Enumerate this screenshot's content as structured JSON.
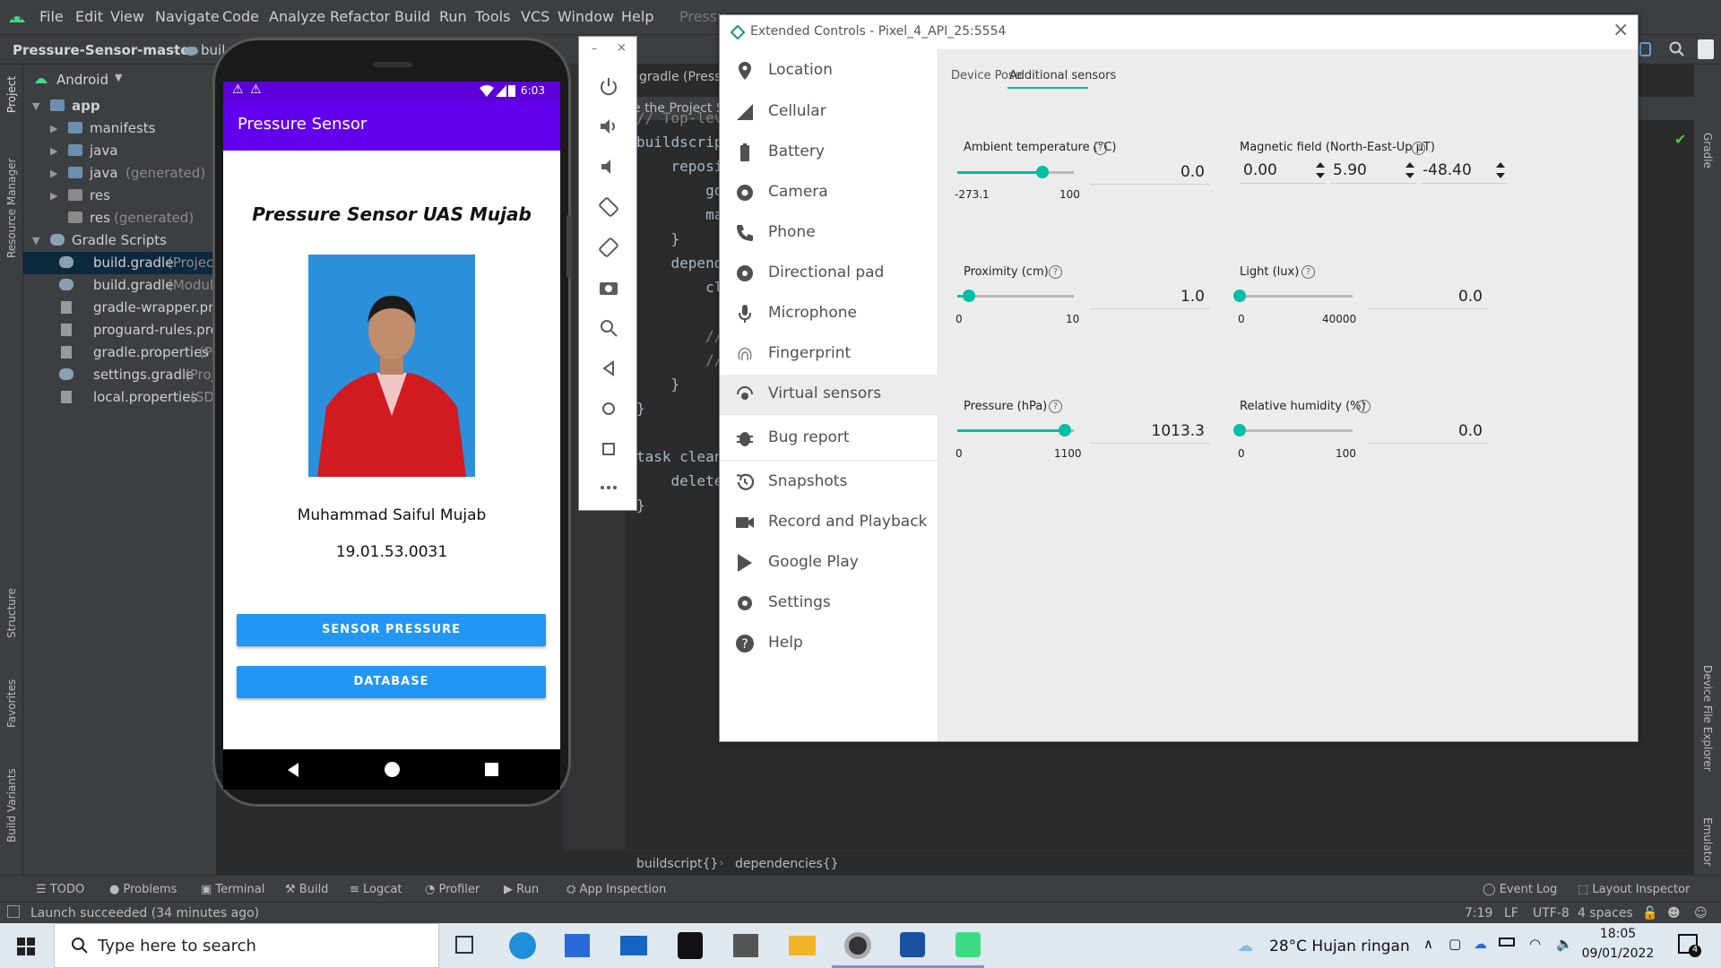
{
  "ide": {
    "menu": [
      "File",
      "Edit",
      "View",
      "Navigate",
      "Code",
      "Analyze",
      "Refactor",
      "Build",
      "Run",
      "Tools",
      "VCS",
      "Window",
      "Help"
    ],
    "menu_title_fragment": "Pressu",
    "nav": {
      "project": "Pressure-Sensor-master",
      "file_fragment": "buil"
    },
    "project_panel": {
      "selector": "Android",
      "tree": [
        {
          "label": "app",
          "hint": ""
        },
        {
          "label": "manifests",
          "hint": ""
        },
        {
          "label": "java",
          "hint": ""
        },
        {
          "label": "java",
          "hint": "(generated)"
        },
        {
          "label": "res",
          "hint": ""
        },
        {
          "label": "res",
          "hint": "(generated)"
        },
        {
          "label": "Gradle Scripts",
          "hint": ""
        },
        {
          "label": "build.gradle",
          "hint": "(Projec"
        },
        {
          "label": "build.gradle",
          "hint": "(Modul"
        },
        {
          "label": "gradle-wrapper.pro",
          "hint": ""
        },
        {
          "label": "proguard-rules.pro",
          "hint": ""
        },
        {
          "label": "gradle.properties",
          "hint": "(P"
        },
        {
          "label": "settings.gradle",
          "hint": "(Proj"
        },
        {
          "label": "local.properties",
          "hint": "(SD"
        }
      ]
    },
    "left_strip": {
      "project": "Project",
      "resource_manager": "Resource Manager",
      "structure": "Structure",
      "favorites": "Favorites",
      "build_variants": "Build Variants"
    },
    "right_strip": {
      "gradle": "Gradle",
      "device_file_explorer": "Device File Explorer",
      "emulator": "Emulator"
    },
    "editor": {
      "tab_fragment": "gradle (Pressure",
      "banner_fragment": "e the Project S",
      "banner_right": "ication",
      "code_lines": [
        "// Top-lev",
        "buildscrip",
        "    reposi",
        "        go",
        "        ma",
        "    }",
        "    depend",
        "        cl",
        "",
        "        //",
        "        //",
        "    }",
        "}",
        "",
        "task clean",
        "    delete",
        "}"
      ],
      "line_numbers": [
        "1",
        "1",
        "1",
        "1",
        "1",
        "1",
        "1",
        "1",
        "1",
        "1",
        "1",
        "1",
        "1",
        "1",
        "1",
        "1",
        "1"
      ],
      "breadcrumb": [
        "buildscript{}",
        "dependencies{}"
      ]
    },
    "bottom_tools": [
      "TODO",
      "Problems",
      "Terminal",
      "Build",
      "Logcat",
      "Profiler",
      "Run",
      "App Inspection"
    ],
    "bottom_tools_right": [
      "Event Log",
      "Layout Inspector"
    ],
    "status": {
      "message": "Launch succeeded (34 minutes ago)",
      "position": "7:19",
      "line_sep": "LF",
      "encoding": "UTF-8",
      "indent": "4 spaces"
    }
  },
  "phone": {
    "time": "6:03",
    "app_title": "Pressure Sensor",
    "heading": "Pressure Sensor UAS Mujab",
    "name": "Muhammad Saiful Mujab",
    "student_id": "19.01.53.0031",
    "button_sensor": "SENSOR PRESSURE",
    "button_database": "DATABASE"
  },
  "extended_controls": {
    "title": "Extended Controls - Pixel_4_API_25:5554",
    "sidebar": [
      {
        "label": "Location",
        "icon": "location-pin-icon"
      },
      {
        "label": "Cellular",
        "icon": "cellular-icon"
      },
      {
        "label": "Battery",
        "icon": "battery-icon"
      },
      {
        "label": "Camera",
        "icon": "camera-aperture-icon"
      },
      {
        "label": "Phone",
        "icon": "phone-icon"
      },
      {
        "label": "Directional pad",
        "icon": "dpad-icon"
      },
      {
        "label": "Microphone",
        "icon": "microphone-icon"
      },
      {
        "label": "Fingerprint",
        "icon": "fingerprint-icon"
      },
      {
        "label": "Virtual sensors",
        "icon": "virtual-sensors-icon"
      },
      {
        "label": "Bug report",
        "icon": "bug-icon"
      },
      {
        "label": "Snapshots",
        "icon": "snapshots-icon"
      },
      {
        "label": "Record and Playback",
        "icon": "record-icon"
      },
      {
        "label": "Google Play",
        "icon": "google-play-icon"
      },
      {
        "label": "Settings",
        "icon": "gear-icon"
      },
      {
        "label": "Help",
        "icon": "help-icon"
      }
    ],
    "active_item": "Virtual sensors",
    "tabs": [
      "Device Pose",
      "Additional sensors"
    ],
    "active_tab": "Additional sensors",
    "sensors": {
      "ambient_temperature": {
        "label": "Ambient temperature (°C)",
        "min": "-273.1",
        "max": "100",
        "value": "0.0",
        "level": 0.732
      },
      "magnetic_field": {
        "label": "Magnetic field (North-East-Up µT)",
        "x": "0.00",
        "y": "5.90",
        "z": "-48.40"
      },
      "proximity": {
        "label": "Proximity (cm)",
        "min": "0",
        "max": "10",
        "value": "1.0",
        "level": 0.1
      },
      "light": {
        "label": "Light (lux)",
        "min": "0",
        "max": "40000",
        "value": "0.0",
        "level": 0.0
      },
      "pressure": {
        "label": "Pressure (hPa)",
        "min": "0",
        "max": "1100",
        "value": "1013.3",
        "level": 0.921
      },
      "relative_humidity": {
        "label": "Relative humidity (%)",
        "min": "0",
        "max": "100",
        "value": "0.0",
        "level": 0.0
      }
    },
    "help_glyph": "?"
  },
  "taskbar": {
    "search_placeholder": "Type here to search",
    "weather": "28°C  Hujan ringan",
    "time": "18:05",
    "date": "09/01/2022",
    "notif_count": "4"
  },
  "colors": {
    "accent_teal": "#00bfa5",
    "app_purple": "#6200ee",
    "button_blue": "#2196f3"
  }
}
